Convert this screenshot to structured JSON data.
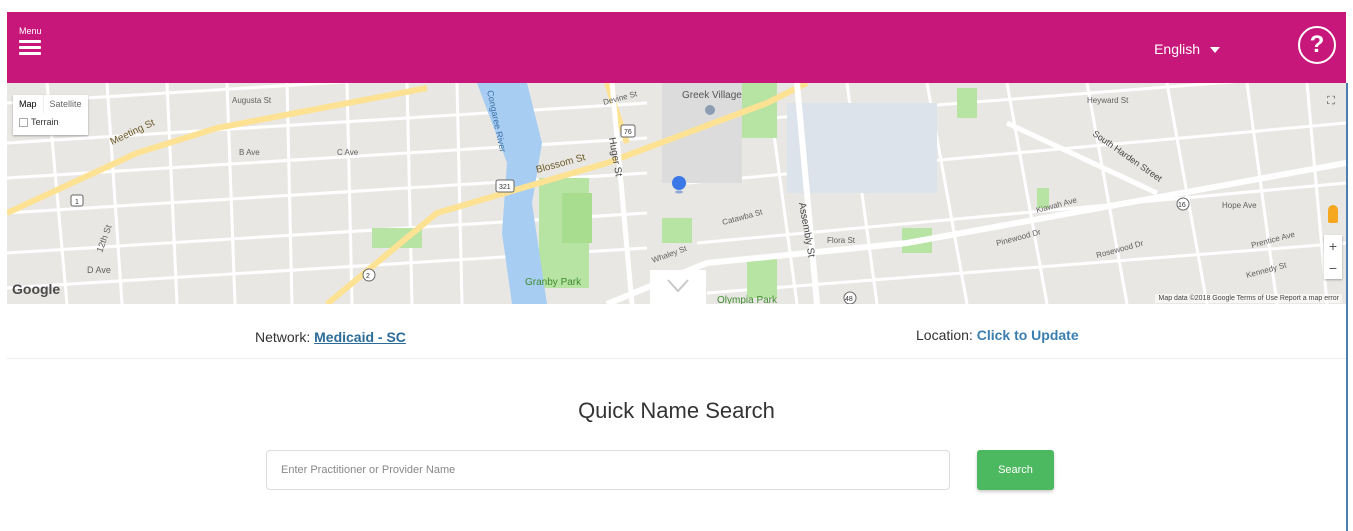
{
  "header": {
    "menu_label": "Menu",
    "menu_icon": "hamburger-icon",
    "language": "English",
    "help_symbol": "?",
    "background_color": "#c8177b"
  },
  "map": {
    "type_tabs": [
      "Map",
      "Satellite"
    ],
    "terrain_label": "Terrain",
    "logo": "Google",
    "credits": "Map data ©2018 Google   Terms of Use   Report a map error",
    "zoom_in": "+",
    "zoom_out": "−",
    "labels": {
      "greek_village": "Greek Village",
      "congaree_river": "Congaree River",
      "blossom_st": "Blossom St",
      "huger_st": "Huger St",
      "meeting_st": "Meeting St",
      "assembly_st": "Assembly St",
      "granby_park": "Granby Park",
      "olympia_park": "Olympia Park",
      "whaley_st": "Whaley St",
      "heyward_st": "Heyward St",
      "south_harden_street": "South Harden Street",
      "devine_st": "Devine St",
      "augusta_st": "Augusta St",
      "b_ave": "B Ave",
      "c_ave": "C Ave",
      "d_ave": "D Ave",
      "twelfth_st": "12th St",
      "catawba_st": "Catawba St",
      "rosewood_dr": "Rosewood Dr",
      "hope_ave": "Hope Ave",
      "prentice_ave": "Prentice Ave",
      "kennedy_st": "Kennedy St",
      "flora_st": "Flora St",
      "pinewood_dr": "Pinewood Dr",
      "kiawah_ave": "Kiawah Ave",
      "shield_76": "76",
      "shield_321": "321",
      "shield_1": "1",
      "shield_2": "2",
      "shield_16": "16",
      "shield_48": "48"
    }
  },
  "network": {
    "label": "Network:",
    "value": "Medicaid - SC"
  },
  "location": {
    "label": "Location:",
    "value": "Click to Update"
  },
  "search": {
    "title": "Quick Name Search",
    "placeholder": "Enter Practitioner or Provider Name",
    "button_label": "Search",
    "button_color": "#4cb860"
  }
}
